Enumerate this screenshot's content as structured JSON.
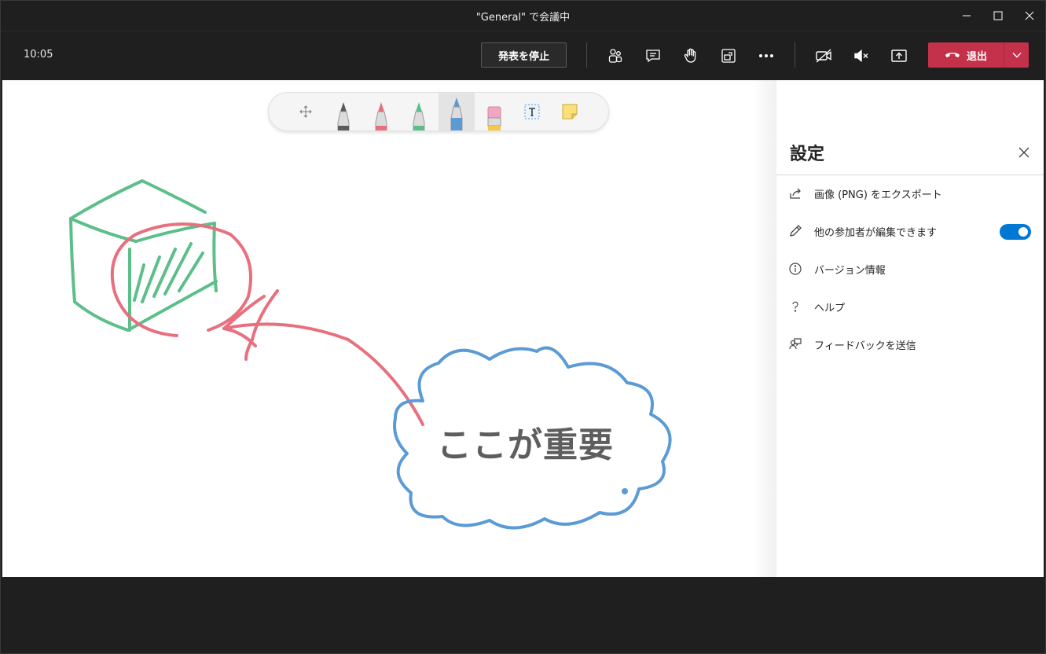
{
  "window": {
    "title": "\"General\" で会議中"
  },
  "meeting": {
    "time": "10:05",
    "stop_presenting_label": "発表を停止",
    "leave_label": "退出"
  },
  "toolbar_icons": [
    "people-icon",
    "chat-icon",
    "raise-hand-icon",
    "share-tray-icon",
    "more-icon",
    "camera-off-icon",
    "mute-icon",
    "share-screen-icon"
  ],
  "whiteboard": {
    "text": "ここが重要",
    "tools": [
      "move",
      "pen-black",
      "pen-red",
      "pen-green",
      "pen-blue",
      "eraser",
      "text",
      "sticky-note"
    ],
    "selected_tool": "pen-blue",
    "colors": {
      "black": "#5a5a5a",
      "red": "#e8707e",
      "green": "#5cbf8a",
      "blue": "#5b9bd5"
    }
  },
  "settings_panel": {
    "title": "設定",
    "items": [
      {
        "label": "画像 (PNG) をエクスポート",
        "icon": "share-icon"
      },
      {
        "label": "他の参加者が編集できます",
        "icon": "pencil-icon",
        "toggle": true
      },
      {
        "label": "バージョン情報",
        "icon": "info-icon"
      },
      {
        "label": "ヘルプ",
        "icon": "help-icon"
      },
      {
        "label": "フィードバックを送信",
        "icon": "feedback-icon"
      }
    ]
  },
  "colors": {
    "leave_red": "#c4314b",
    "toggle_blue": "#0078d4",
    "dark_bg": "#1f1f1f"
  }
}
